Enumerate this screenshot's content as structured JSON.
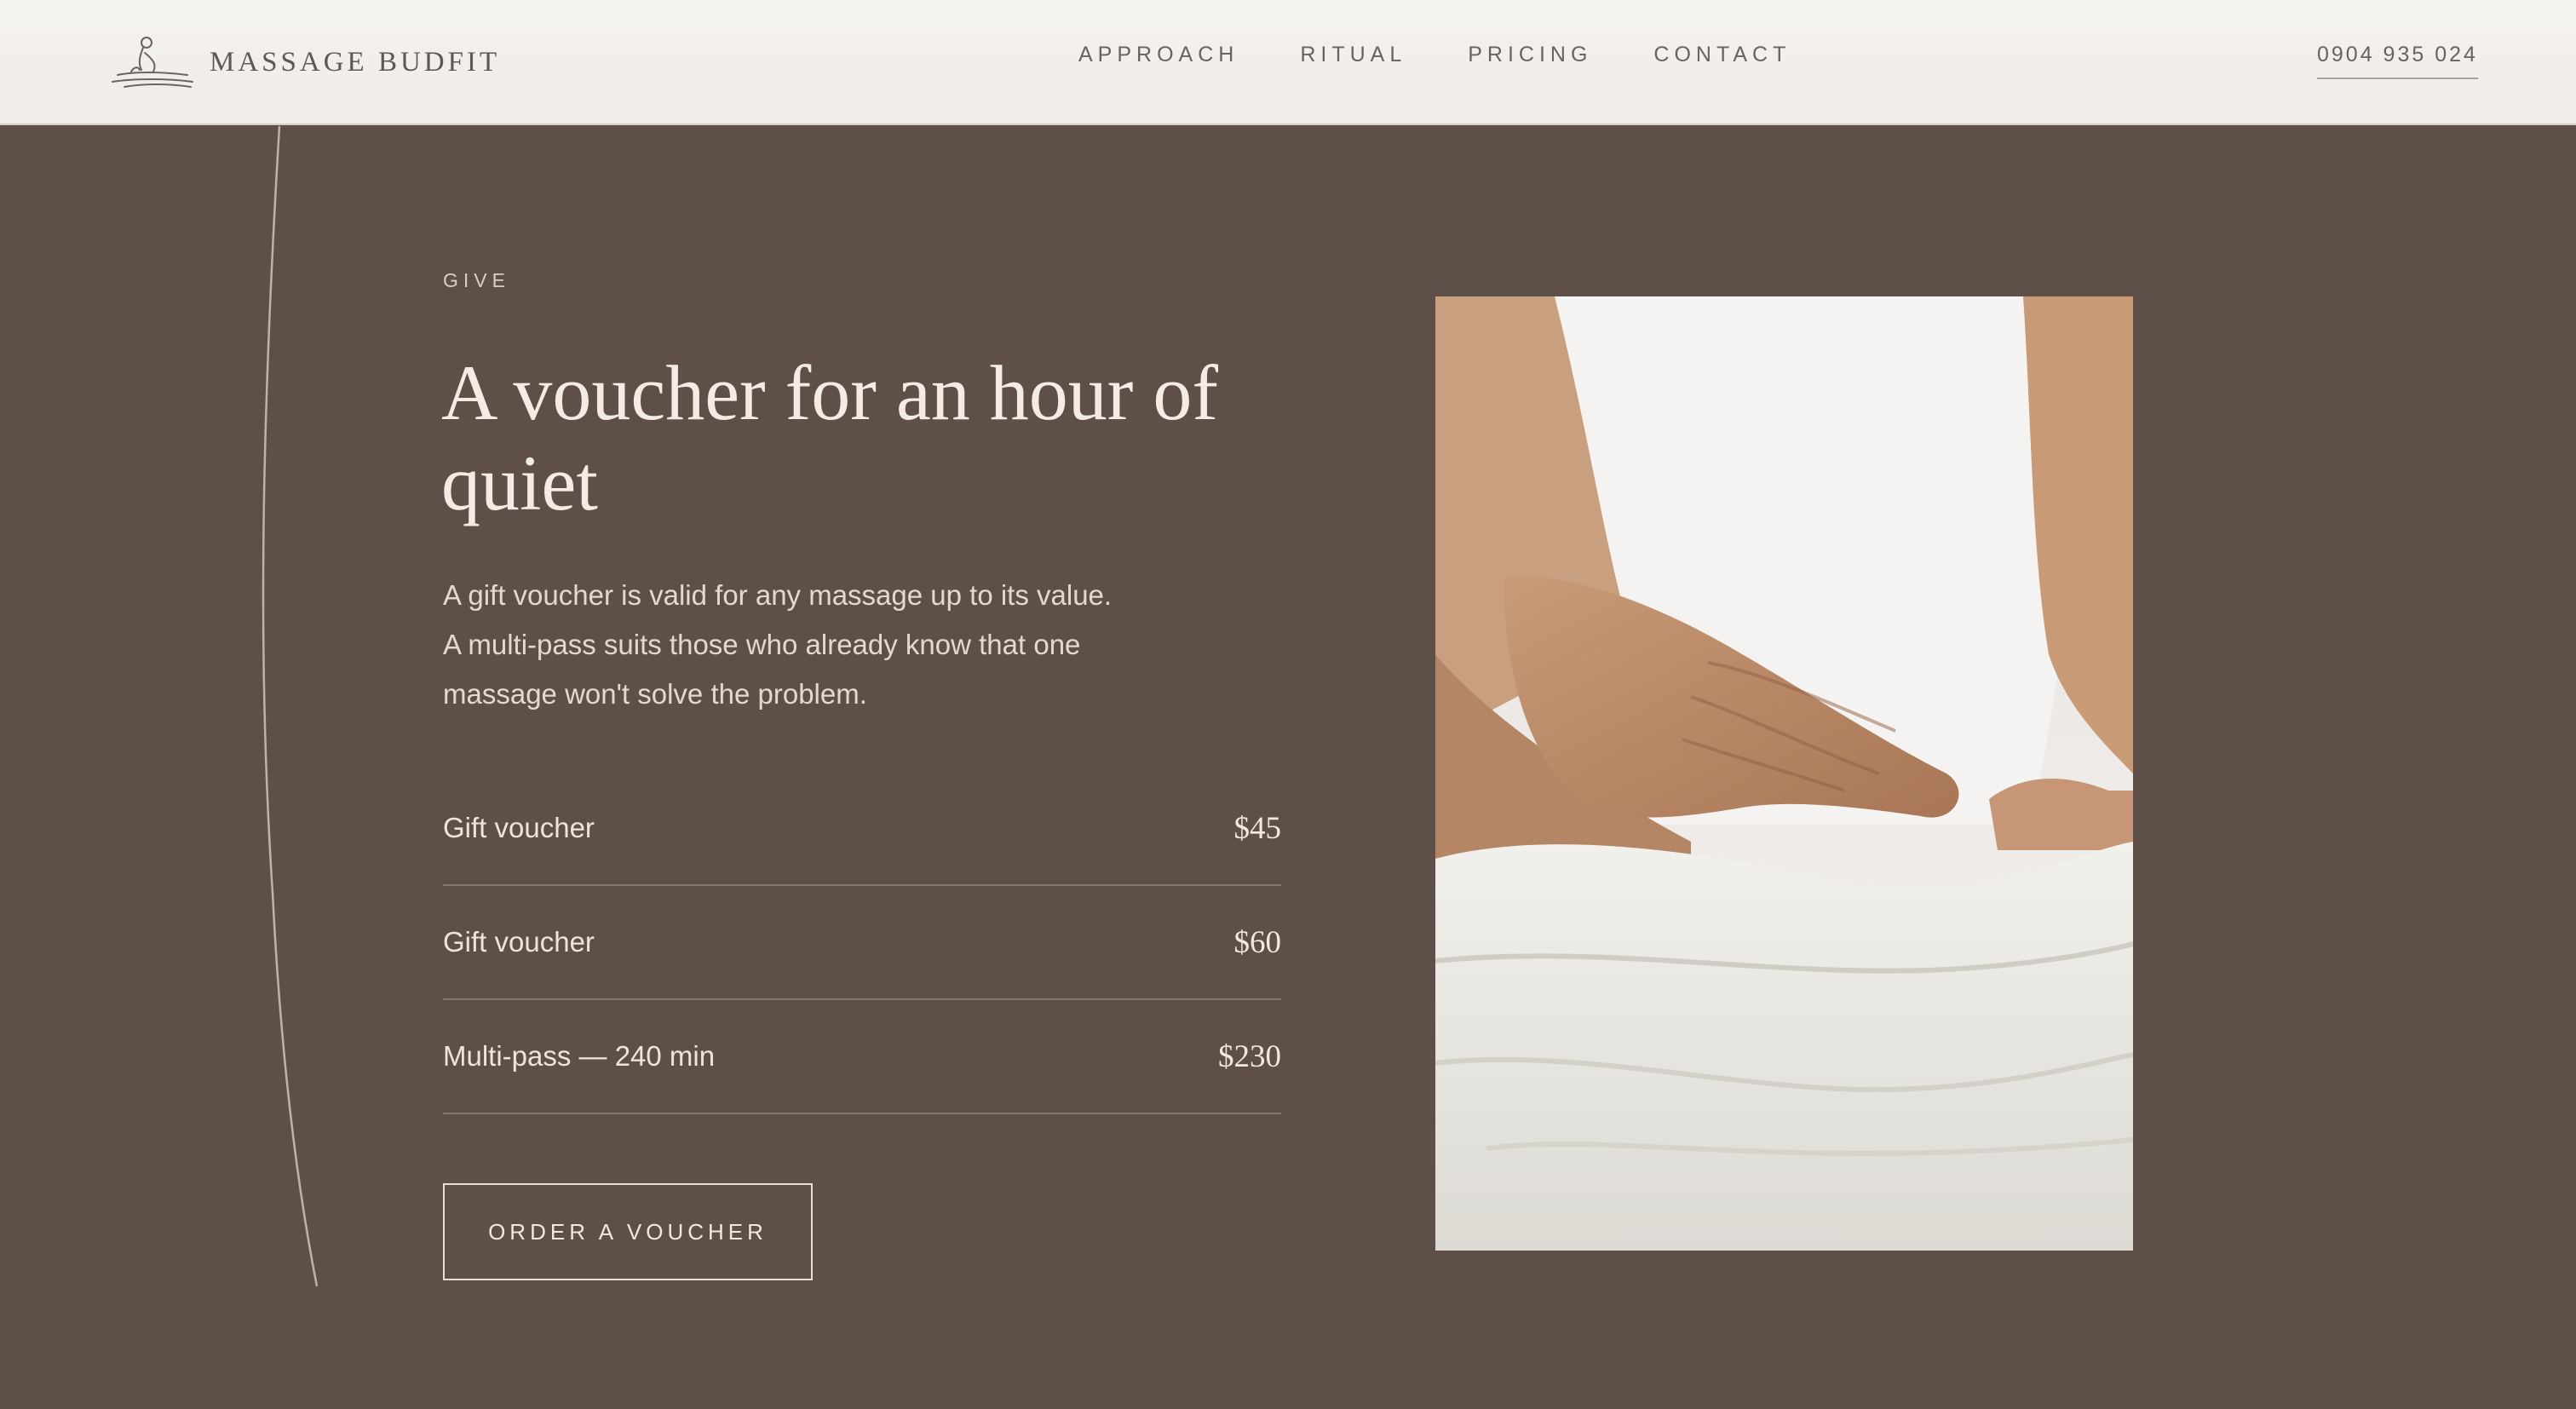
{
  "header": {
    "brand": "Massage Budfit",
    "nav": [
      "APPROACH",
      "RITUAL",
      "PRICING",
      "CONTACT"
    ],
    "phone": "0904 935 024"
  },
  "section": {
    "eyebrow": "GIVE",
    "headline": "A voucher for an hour of quiet",
    "description": "A gift voucher is valid for any massage up to its value. A multi-pass suits those who already know that one massage won't solve the problem.",
    "items": [
      {
        "name": "Gift voucher",
        "price": "$45"
      },
      {
        "name": "Gift voucher",
        "price": "$60"
      },
      {
        "name": "Multi-pass — 240 min",
        "price": "$230"
      }
    ],
    "cta": "ORDER A VOUCHER"
  },
  "image": {
    "icon": "massage-photo"
  },
  "colors": {
    "background": "#5e5049",
    "header": "#f3f0ec",
    "text": "#efe6de"
  }
}
